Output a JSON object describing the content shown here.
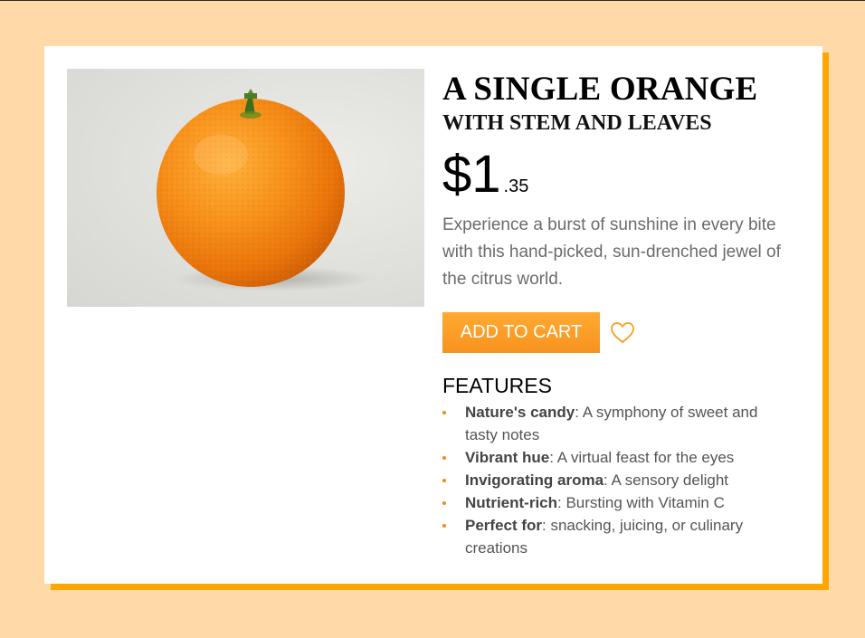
{
  "product": {
    "title": "A SINGLE ORANGE",
    "subtitle": "WITH STEM AND LEAVES",
    "price_main": "$1",
    "price_cents": ".35",
    "description": "Experience a burst of sunshine in every bite with this hand-picked, sun-drenched jewel of the citrus world.",
    "image_icon": "orange-photo"
  },
  "actions": {
    "add_to_cart_label": "ADD TO CART",
    "favorite_icon": "heart-icon"
  },
  "features": {
    "heading": "FEATURES",
    "items": [
      {
        "name": "Nature's candy",
        "text": ": A symphony of sweet and tasty notes"
      },
      {
        "name": "Vibrant hue",
        "text": ": A virtual feast for the eyes"
      },
      {
        "name": "Invigorating aroma",
        "text": ": A sensory delight"
      },
      {
        "name": "Nutrient-rich",
        "text": ": Bursting with Vitamin C"
      },
      {
        "name": "Perfect for",
        "text": ": snacking, juicing, or culinary creations"
      }
    ]
  },
  "colors": {
    "page_background": "#ffdaa8",
    "card_shadow": "#ffa600",
    "button": "#f7931e",
    "bullet": "#f08a1c"
  }
}
